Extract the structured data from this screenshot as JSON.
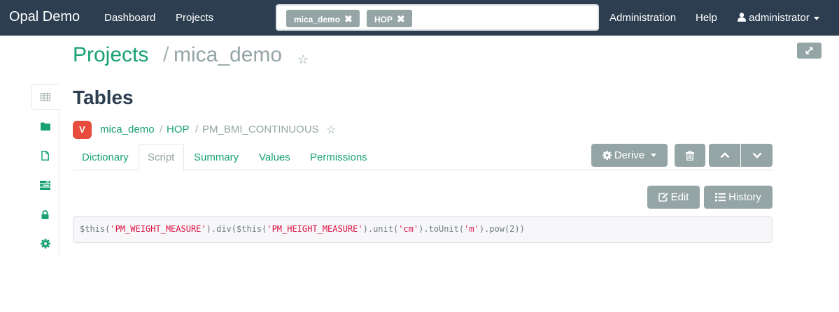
{
  "navbar": {
    "brand": "Opal Demo",
    "links": [
      "Dashboard",
      "Projects"
    ],
    "search_tags": [
      "mica_demo",
      "HOP"
    ],
    "right_links": [
      "Administration",
      "Help"
    ],
    "user": "administrator"
  },
  "header": {
    "projects_link": "Projects",
    "separator": "/",
    "current_project": "mica_demo"
  },
  "sidebar": {
    "items": [
      "table-icon",
      "folder-icon",
      "file-icon",
      "tasks-icon",
      "lock-icon",
      "gear-icon"
    ],
    "active_index": 0
  },
  "page_title": "Tables",
  "table_path": {
    "badge": "V",
    "project": "mica_demo",
    "sep": "/",
    "table": "HOP",
    "variable": "PM_BMI_CONTINUOUS"
  },
  "tabs": [
    {
      "label": "Dictionary",
      "active": false
    },
    {
      "label": "Script",
      "active": true
    },
    {
      "label": "Summary",
      "active": false
    },
    {
      "label": "Values",
      "active": false
    },
    {
      "label": "Permissions",
      "active": false
    }
  ],
  "toolbar": {
    "derive_label": "Derive",
    "edit_label": "Edit",
    "history_label": "History"
  },
  "script": {
    "parts": [
      {
        "text": "$this(",
        "kind": "plain"
      },
      {
        "text": "'PM_WEIGHT_MEASURE'",
        "kind": "str"
      },
      {
        "text": ").div($this(",
        "kind": "plain"
      },
      {
        "text": "'PM_HEIGHT_MEASURE'",
        "kind": "str"
      },
      {
        "text": ").unit(",
        "kind": "plain"
      },
      {
        "text": "'cm'",
        "kind": "str"
      },
      {
        "text": ").toUnit(",
        "kind": "plain"
      },
      {
        "text": "'m'",
        "kind": "str"
      },
      {
        "text": ").pow(2))",
        "kind": "plain"
      }
    ]
  },
  "colors": {
    "navbar": "#2c3e50",
    "link": "#18a174",
    "muted": "#95a5a6",
    "badge": "#e74c3c",
    "code_string": "#dd1144"
  }
}
